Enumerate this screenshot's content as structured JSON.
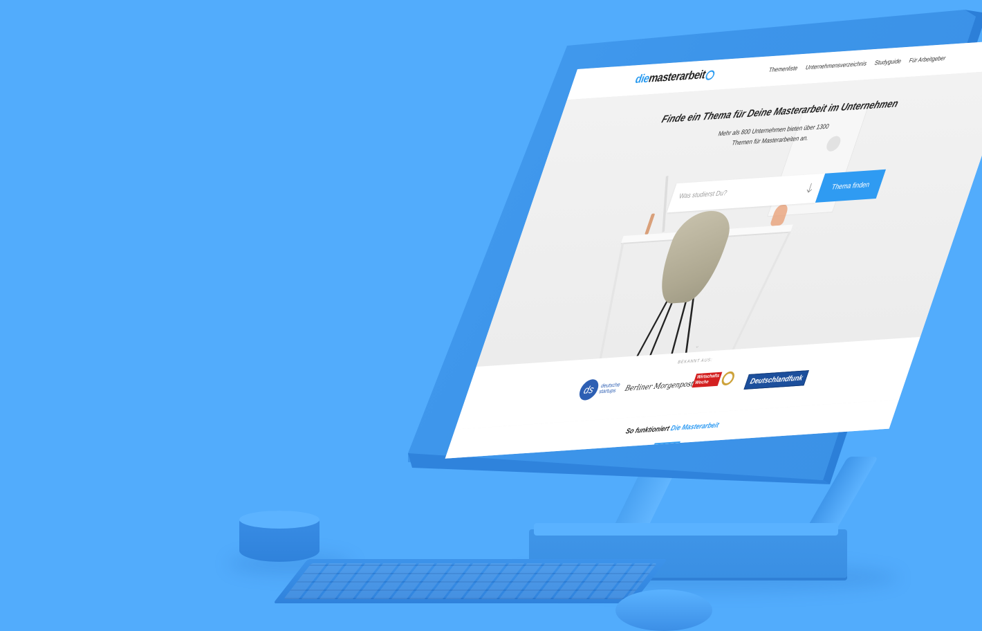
{
  "colors": {
    "background": "#52acfc",
    "accent": "#2f9bf2",
    "device": "#3d95ea"
  },
  "nav": {
    "logo_prefix": "die",
    "logo_main": "masterarbeit",
    "items": [
      {
        "label": "Themenliste"
      },
      {
        "label": "Unternehmensverzeichnis"
      },
      {
        "label": "Studyguide"
      },
      {
        "label": "Für Arbeitgeber"
      }
    ]
  },
  "hero": {
    "title": "Finde ein Thema für Deine Masterarbeit im Unternehmen",
    "subtitle_line1": "Mehr als 800 Unternehmen bieten über 1300",
    "subtitle_line2": "Themen für Masterarbeiten an.",
    "search_placeholder": "Was studierst Du?",
    "search_button": "Thema finden",
    "scroll_glyph": "⌄"
  },
  "press": {
    "label": "BEKANNT AUS:",
    "logos": {
      "deutsche_startups": {
        "mark": "ds",
        "line1": "deutsche",
        "line2": "startups"
      },
      "berliner_morgenpost": "Berliner Morgenpost",
      "wirtschaftswoche": {
        "line1": "Wirtschafts",
        "line2": "Woche"
      },
      "deutschlandfunk": "Deutschlandfunk"
    }
  },
  "how": {
    "title_prefix": "So funktioniert",
    "title_accent": "Die Masterarbeit"
  }
}
